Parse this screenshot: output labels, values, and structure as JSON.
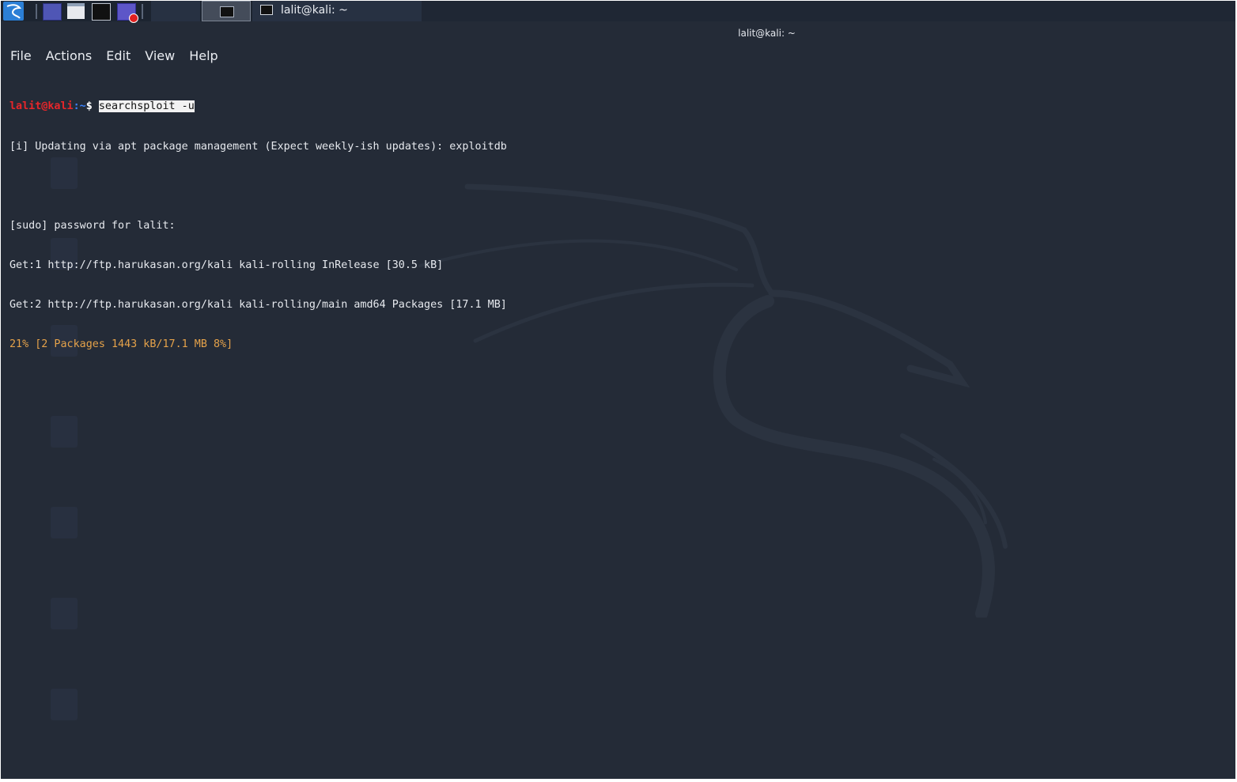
{
  "taskbar": {
    "task_label": "lalit@kali: ~",
    "icons": [
      "kali-menu-icon",
      "show-desktop-icon",
      "file-manager-icon",
      "terminal-icon",
      "screen-recorder-icon"
    ]
  },
  "window": {
    "title": "lalit@kali: ~"
  },
  "menu": {
    "file": "File",
    "actions": "Actions",
    "edit": "Edit",
    "view": "View",
    "help": "Help"
  },
  "terminal": {
    "prompt_user": "lalit@kali",
    "prompt_path": ":~",
    "prompt_dollar": "$",
    "command": "searchsploit -u",
    "line_updating": "[i] Updating via apt package management (Expect weekly-ish updates): exploitdb",
    "line_sudo": "[sudo] password for lalit:",
    "line_get1": "Get:1 http://ftp.harukasan.org/kali kali-rolling InRelease [30.5 kB]",
    "line_get2": "Get:2 http://ftp.harukasan.org/kali kali-rolling/main amd64 Packages [17.1 MB]",
    "line_progress": "21% [2 Packages 1443 kB/17.1 MB 8%]"
  },
  "colors": {
    "background": "#242b37",
    "prompt_user": "#e8262a",
    "prompt_path": "#3a82ff",
    "progress": "#e5a24a",
    "taskbar": "#1c2430"
  }
}
